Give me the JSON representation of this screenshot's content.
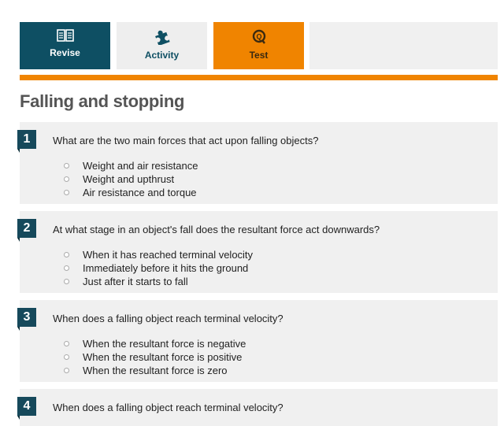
{
  "tabs": [
    {
      "label": "Revise",
      "icon": "book-icon"
    },
    {
      "label": "Activity",
      "icon": "puzzle-icon"
    },
    {
      "label": "Test",
      "icon": "quiz-icon"
    }
  ],
  "title": "Falling and stopping",
  "colors": {
    "accent": "#f08400",
    "nav_dark": "#0e4f63",
    "question_bg": "#f0f0f0"
  },
  "questions": [
    {
      "number": "1",
      "text": "What are the two main forces that act upon falling objects?",
      "options": [
        "Weight and air resistance",
        "Weight and upthrust",
        "Air resistance and torque"
      ]
    },
    {
      "number": "2",
      "text": "At what stage in an object's fall does the resultant force act downwards?",
      "options": [
        "When it has reached terminal velocity",
        "Immediately before it hits the ground",
        "Just after it starts to fall"
      ]
    },
    {
      "number": "3",
      "text": "When does a falling object reach terminal velocity?",
      "options": [
        "When the resultant force is negative",
        "When the resultant force is positive",
        "When the resultant force is zero"
      ]
    },
    {
      "number": "4",
      "text": "When does a falling object reach terminal velocity?"
    }
  ]
}
